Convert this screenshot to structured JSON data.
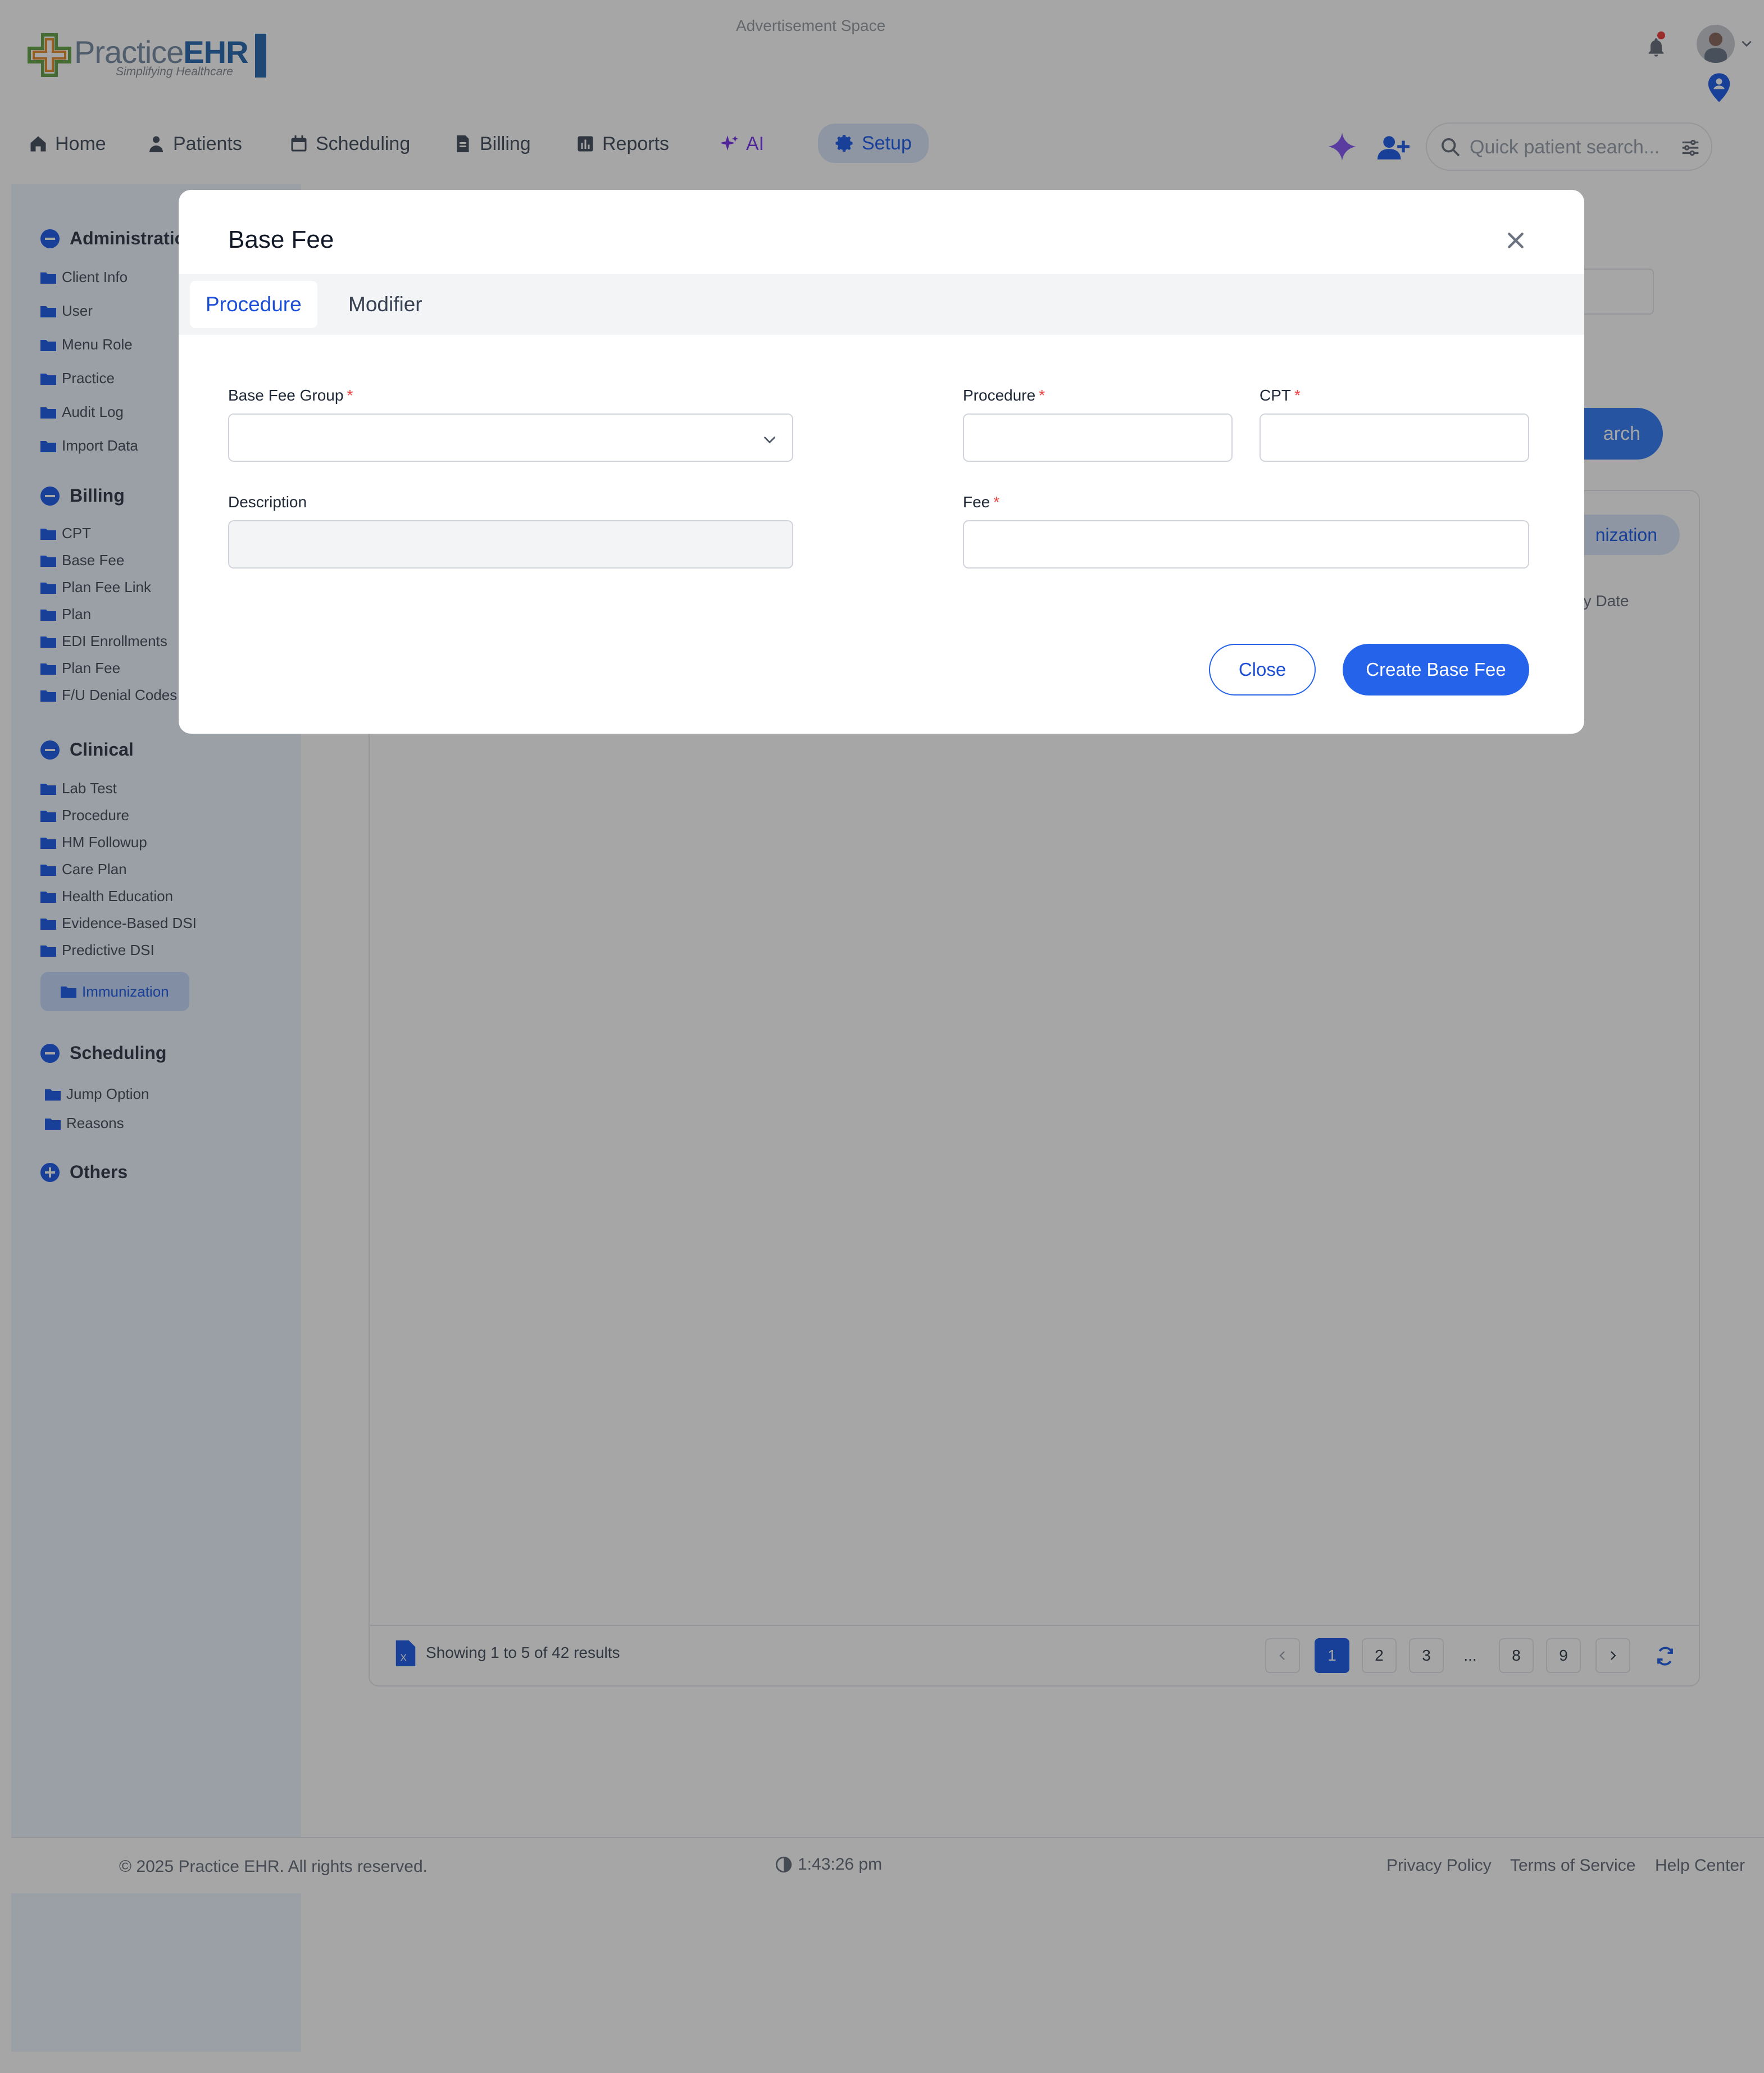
{
  "header": {
    "logo_text_a": "Practice",
    "logo_text_b": "EHR",
    "logo_tagline": "Simplifying Healthcare",
    "ad_space": "Advertisement Space"
  },
  "nav": {
    "items": [
      {
        "label": "Home"
      },
      {
        "label": "Patients"
      },
      {
        "label": "Scheduling"
      },
      {
        "label": "Billing"
      },
      {
        "label": "Reports"
      },
      {
        "label": "AI"
      },
      {
        "label": "Setup"
      }
    ],
    "search_placeholder": "Quick patient search..."
  },
  "sidebar": {
    "administration": {
      "title": "Administration",
      "items": [
        "Client Info",
        "User",
        "Menu Role",
        "Practice",
        "Audit Log",
        "Import Data"
      ]
    },
    "billing": {
      "title": "Billing",
      "items": [
        "CPT",
        "Base Fee",
        "Plan Fee Link",
        "Plan",
        "EDI Enrollments",
        "Plan Fee",
        "F/U Denial Codes"
      ]
    },
    "clinical": {
      "title": "Clinical",
      "items": [
        "Lab Test",
        "Procedure",
        "HM Followup",
        "Care Plan",
        "Health Education",
        "Evidence-Based DSI",
        "Predictive DSI",
        "Immunization"
      ]
    },
    "scheduling": {
      "title": "Scheduling",
      "items": [
        "Jump Option",
        "Reasons"
      ]
    },
    "others": {
      "title": "Others"
    }
  },
  "background": {
    "search_button_partial": "arch",
    "pill_partial": "nization",
    "column_partial": "ntry Date",
    "showing": "Showing 1 to 5 of 42 results",
    "pages": [
      "1",
      "2",
      "3",
      "...",
      "8",
      "9"
    ],
    "active_page": "1"
  },
  "footer": {
    "copyright": "© 2025 Practice EHR. All rights reserved.",
    "clock": "1:43:26 pm",
    "links": [
      "Privacy Policy",
      "Terms of Service",
      "Help Center"
    ]
  },
  "modal": {
    "title": "Base Fee",
    "tabs": [
      {
        "label": "Procedure",
        "active": true
      },
      {
        "label": "Modifier",
        "active": false
      }
    ],
    "fields": {
      "base_fee_group": {
        "label": "Base Fee Group",
        "required": "*",
        "value": ""
      },
      "procedure": {
        "label": "Procedure",
        "required": "*",
        "value": ""
      },
      "cpt": {
        "label": "CPT",
        "required": "*",
        "value": ""
      },
      "description": {
        "label": "Description",
        "value": ""
      },
      "fee": {
        "label": "Fee",
        "required": "*",
        "value": ""
      }
    },
    "close_label": "Close",
    "create_label": "Create Base Fee"
  },
  "colors": {
    "primary": "#2563eb",
    "required": "#ef4444",
    "overlay": "rgba(0,0,0,0.35)"
  }
}
